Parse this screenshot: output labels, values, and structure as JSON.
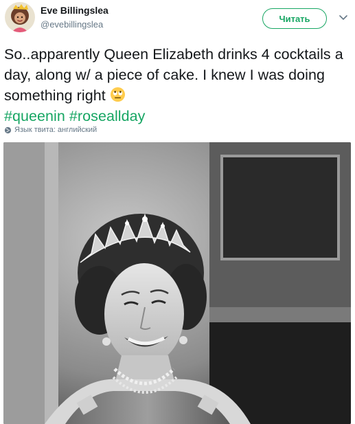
{
  "author": {
    "display_name": "Eve Billingslea",
    "handle": "@evebillingslea"
  },
  "follow_button": {
    "label": "Читать"
  },
  "tweet": {
    "text_part1": "So..apparently Queen Elizabeth drinks 4 cocktails a day, along w/ a piece of cake. I knew I was doing something right ",
    "emoji": "eye-roll-emoji",
    "hashtags": [
      "#queenin",
      "#roseallday"
    ]
  },
  "language_note": "Язык твита: английский",
  "media": {
    "type": "photo",
    "description_icon": "photo-image"
  },
  "colors": {
    "accent": "#17a663",
    "text": "#14171a",
    "secondary": "#657786"
  }
}
